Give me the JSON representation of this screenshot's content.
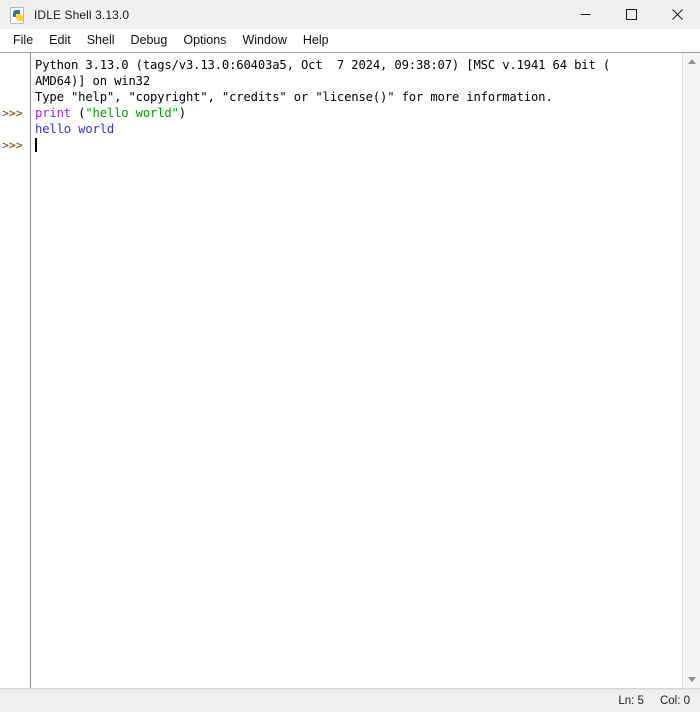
{
  "window": {
    "title": "IDLE Shell 3.13.0",
    "icon": "python-idle-icon",
    "controls": {
      "minimize": "minimize-button",
      "maximize": "maximize-button",
      "close": "close-button"
    }
  },
  "menubar": {
    "items": [
      {
        "label": "File"
      },
      {
        "label": "Edit"
      },
      {
        "label": "Shell"
      },
      {
        "label": "Debug"
      },
      {
        "label": "Options"
      },
      {
        "label": "Window"
      },
      {
        "label": "Help"
      }
    ]
  },
  "shell": {
    "lines": [
      {
        "prompt": "",
        "segments": [
          {
            "text": "Python 3.13.0 (tags/v3.13.0:60403a5, Oct  7 2024, 09:38:07) [MSC v.1941 64 bit (",
            "kind": "plain"
          }
        ]
      },
      {
        "prompt": "",
        "segments": [
          {
            "text": "AMD64)] on win32",
            "kind": "plain"
          }
        ]
      },
      {
        "prompt": "",
        "segments": [
          {
            "text": "Type \"help\", \"copyright\", \"credits\" or \"license()\" for more information.",
            "kind": "plain"
          }
        ]
      },
      {
        "prompt": ">>>",
        "segments": [
          {
            "text": "print",
            "kind": "builtin"
          },
          {
            "text": " (",
            "kind": "plain"
          },
          {
            "text": "\"hello world\"",
            "kind": "string"
          },
          {
            "text": ")",
            "kind": "plain"
          }
        ]
      },
      {
        "prompt": "",
        "segments": [
          {
            "text": "hello world",
            "kind": "output"
          }
        ]
      },
      {
        "prompt": ">>>",
        "segments": [],
        "caret": true
      }
    ]
  },
  "scrollbar": {
    "up_arrow": "scroll-up-arrow",
    "down_arrow": "scroll-down-arrow"
  },
  "statusbar": {
    "line": "Ln: 5",
    "column": "Col: 0"
  },
  "colors": {
    "titlebar_bg": "#f0f0f0",
    "menubar_bg": "#ffffff",
    "editor_bg": "#ffffff",
    "prompt": "#804000",
    "builtin": "#a020f0",
    "string": "#00a000",
    "output": "#3333cc",
    "plain": "#000000",
    "statusbar_bg": "#f0f0f0"
  }
}
